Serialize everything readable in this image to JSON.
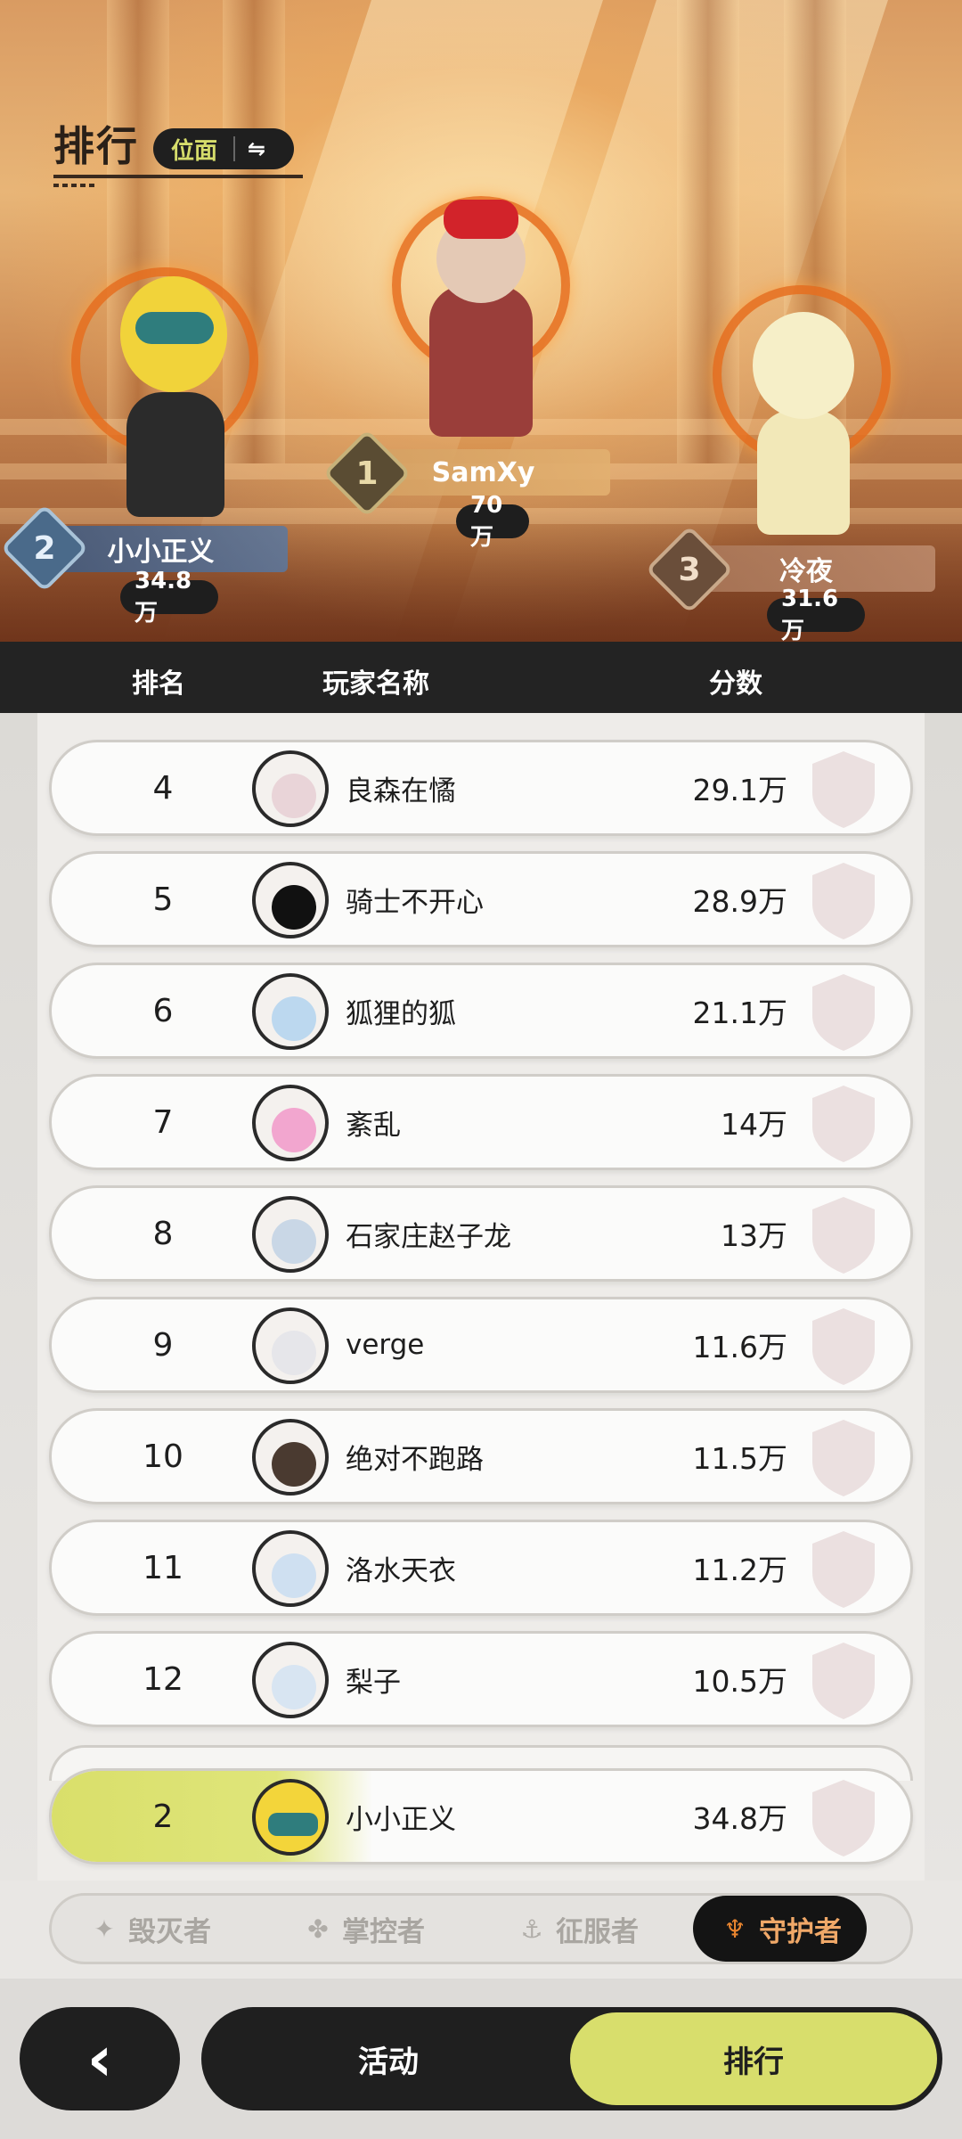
{
  "header": {
    "title": "排行",
    "realm_chip_label": "位面",
    "realm_chip_swap": "⇋"
  },
  "podium": [
    {
      "rank": "1",
      "name": "SamXy",
      "score": "70万"
    },
    {
      "rank": "2",
      "name": "小小正义",
      "score": "34.8万"
    },
    {
      "rank": "3",
      "name": "冷夜",
      "score": "31.6万"
    }
  ],
  "table": {
    "columns": {
      "rank": "排名",
      "player": "玩家名称",
      "score": "分数"
    },
    "rows": [
      {
        "rank": "4",
        "name": "良森在憰",
        "score": "29.1万",
        "avatar_color": "#e9d4d8"
      },
      {
        "rank": "5",
        "name": "骑士不开心",
        "score": "28.9万",
        "avatar_color": "#111111"
      },
      {
        "rank": "6",
        "name": "狐狸的狐",
        "score": "21.1万",
        "avatar_color": "#bcd8ef"
      },
      {
        "rank": "7",
        "name": "紊乱",
        "score": "14万",
        "avatar_color": "#f2a6cf"
      },
      {
        "rank": "8",
        "name": "石家庄赵子龙",
        "score": "13万",
        "avatar_color": "#c9d7e6"
      },
      {
        "rank": "9",
        "name": "verge",
        "score": "11.6万",
        "avatar_color": "#e6e6ea"
      },
      {
        "rank": "10",
        "name": "绝对不跑路",
        "score": "11.5万",
        "avatar_color": "#4a3a30"
      },
      {
        "rank": "11",
        "name": "洛水天衣",
        "score": "11.2万",
        "avatar_color": "#cfe0f1"
      },
      {
        "rank": "12",
        "name": "梨子",
        "score": "10.5万",
        "avatar_color": "#d8e5f2"
      }
    ],
    "my_row": {
      "rank": "2",
      "name": "小小正义",
      "score": "34.8万",
      "avatar_color": "#f3d53a"
    }
  },
  "categories": [
    {
      "label": "毁灭者",
      "icon": "destroyer-icon",
      "active": false
    },
    {
      "label": "掌控者",
      "icon": "controller-icon",
      "active": false
    },
    {
      "label": "征服者",
      "icon": "conqueror-icon",
      "active": false
    },
    {
      "label": "守护者",
      "icon": "guardian-icon",
      "active": true
    }
  ],
  "bottom_nav": {
    "back": "‹",
    "tabs": [
      {
        "label": "活动",
        "active": false
      },
      {
        "label": "排行",
        "active": true
      }
    ]
  },
  "colors": {
    "accent": "#d8de6c",
    "active_category_text": "#f0a868",
    "dark": "#1f1f1f"
  }
}
